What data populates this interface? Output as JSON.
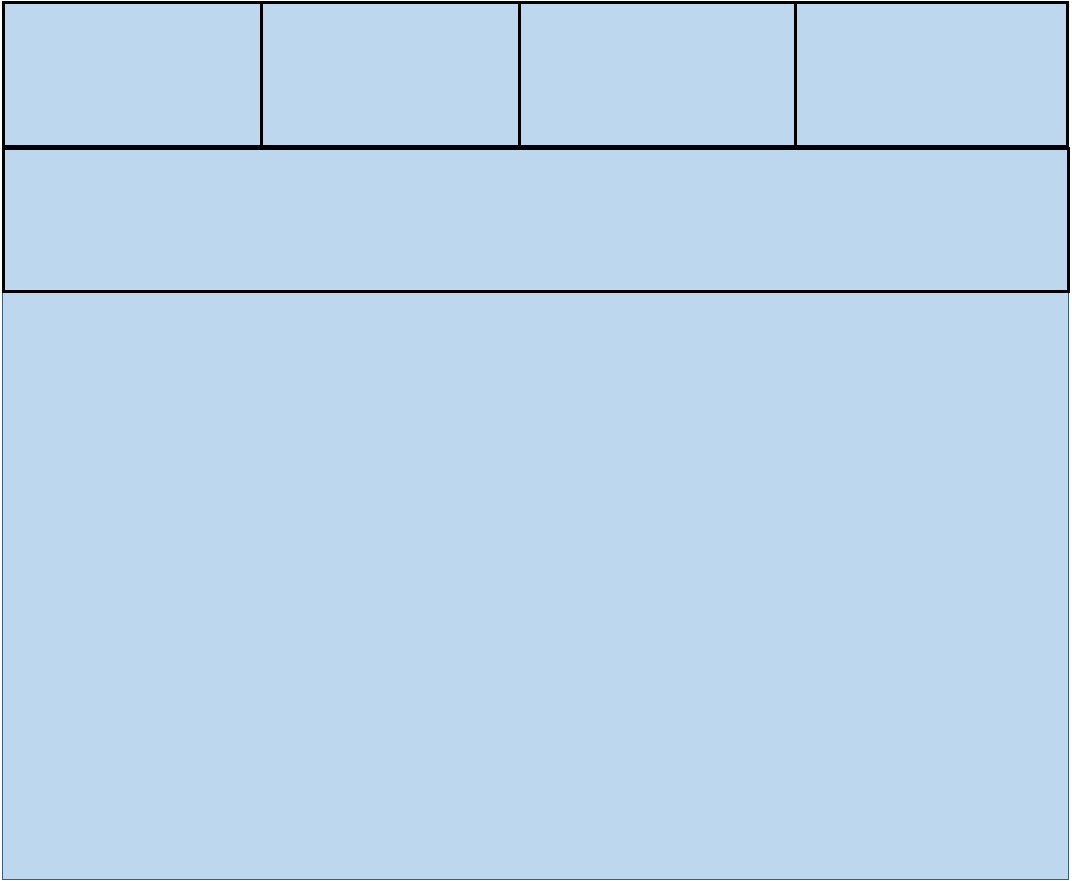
{
  "diagram": {
    "fill_color": "#bdd7ee",
    "border_color": "#000000",
    "panel_border_color": "#3a5a7e",
    "top_row": {
      "cells": [
        {
          "label": ""
        },
        {
          "label": ""
        },
        {
          "label": ""
        },
        {
          "label": ""
        }
      ]
    },
    "band": {
      "label": ""
    },
    "main_panel": {
      "label": ""
    }
  }
}
